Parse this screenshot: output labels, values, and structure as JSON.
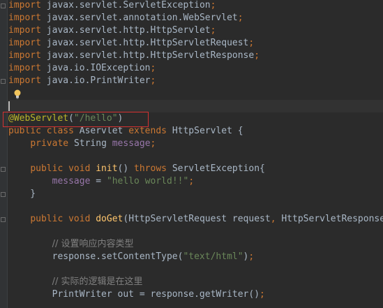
{
  "editor": {
    "lines": [
      [
        [
          "kw",
          "import"
        ],
        [
          "plain",
          " javax.servlet.ServletException"
        ],
        [
          "kw",
          ";"
        ]
      ],
      [
        [
          "kw",
          "import"
        ],
        [
          "plain",
          " javax.servlet.annotation.WebServlet"
        ],
        [
          "kw",
          ";"
        ]
      ],
      [
        [
          "kw",
          "import"
        ],
        [
          "plain",
          " javax.servlet.http.HttpServlet"
        ],
        [
          "kw",
          ";"
        ]
      ],
      [
        [
          "kw",
          "import"
        ],
        [
          "plain",
          " javax.servlet.http.HttpServletRequest"
        ],
        [
          "kw",
          ";"
        ]
      ],
      [
        [
          "kw",
          "import"
        ],
        [
          "plain",
          " javax.servlet.http.HttpServletResponse"
        ],
        [
          "kw",
          ";"
        ]
      ],
      [
        [
          "kw",
          "import"
        ],
        [
          "plain",
          " java.io.IOException"
        ],
        [
          "kw",
          ";"
        ]
      ],
      [
        [
          "kw",
          "import"
        ],
        [
          "plain",
          " java.io.PrintWriter"
        ],
        [
          "kw",
          ";"
        ]
      ],
      [],
      [],
      [
        [
          "ann",
          "@WebServlet"
        ],
        [
          "plain",
          "("
        ],
        [
          "str",
          "\"/hello\""
        ],
        [
          "plain",
          ")"
        ]
      ],
      [
        [
          "kw",
          "public class "
        ],
        [
          "plain",
          "Aservlet "
        ],
        [
          "kw",
          "extends "
        ],
        [
          "plain",
          "HttpServlet {"
        ]
      ],
      [
        [
          "plain",
          "    "
        ],
        [
          "kw",
          "private "
        ],
        [
          "plain",
          "String "
        ],
        [
          "field",
          "message"
        ],
        [
          "kw",
          ";"
        ]
      ],
      [],
      [
        [
          "plain",
          "    "
        ],
        [
          "kw",
          "public void "
        ],
        [
          "method",
          "init"
        ],
        [
          "plain",
          "() "
        ],
        [
          "kw",
          "throws "
        ],
        [
          "plain",
          "ServletException{"
        ]
      ],
      [
        [
          "plain",
          "        "
        ],
        [
          "field",
          "message "
        ],
        [
          "plain",
          "= "
        ],
        [
          "str",
          "\"hello world!!\""
        ],
        [
          "kw",
          ";"
        ]
      ],
      [
        [
          "plain",
          "    }"
        ]
      ],
      [],
      [
        [
          "plain",
          "    "
        ],
        [
          "kw",
          "public void "
        ],
        [
          "method",
          "doGet"
        ],
        [
          "plain",
          "(HttpServletRequest request"
        ],
        [
          "kw",
          ", "
        ],
        [
          "plain",
          "HttpServletResponse"
        ]
      ],
      [],
      [
        [
          "plain",
          "        "
        ],
        [
          "cm",
          "// 设置响应内容类型"
        ]
      ],
      [
        [
          "plain",
          "        response.setContentType("
        ],
        [
          "str",
          "\"text/html\""
        ],
        [
          "plain",
          ")"
        ],
        [
          "kw",
          ";"
        ]
      ],
      [],
      [
        [
          "plain",
          "        "
        ],
        [
          "cm",
          "// 实际的逻辑是在这里"
        ]
      ],
      [
        [
          "plain",
          "        PrintWriter out = response.getWriter()"
        ],
        [
          "kw",
          ";"
        ]
      ]
    ]
  }
}
